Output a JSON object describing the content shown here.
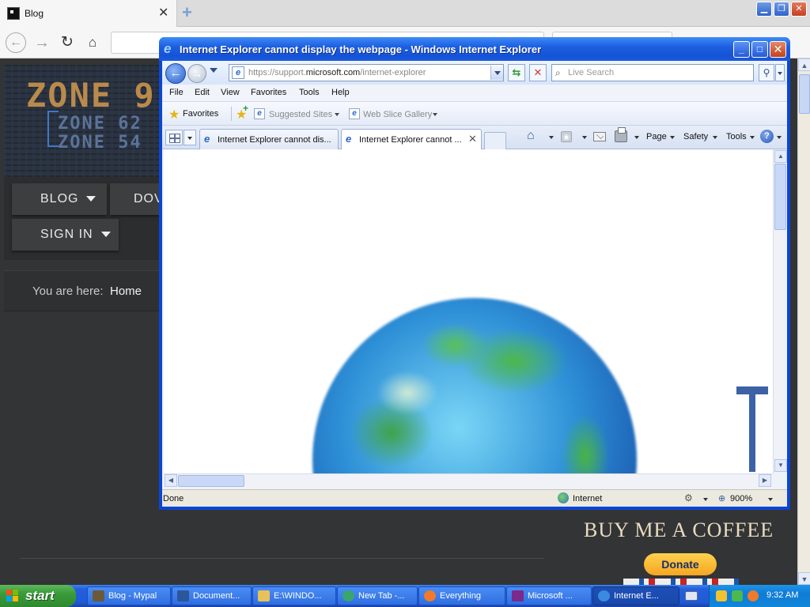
{
  "firefox": {
    "tab_title": "Blog",
    "tab_close": "✕",
    "new_tab": "+",
    "icons": [
      "back-icon",
      "forward-icon",
      "reload-icon",
      "home-icon"
    ]
  },
  "site": {
    "logo_main": "ZONE 9",
    "logo_line1": "ZONE 62",
    "logo_line2": "ZONE 54",
    "menu": {
      "blog": "BLOG",
      "downloads_partial": "DOV",
      "sign_in": "SIGN IN"
    },
    "breadcrumb_label": "You are here:",
    "breadcrumb_home": "Home",
    "coffee_title": "BUY ME A COFFEE",
    "donate_label": "Donate"
  },
  "ie": {
    "title": "Internet Explorer cannot display the webpage - Windows Internet Explorer",
    "url_prefix": "https://support.",
    "url_domain": "microsoft.com",
    "url_path": "/internet-explorer",
    "search_placeholder": "Live Search",
    "menu": [
      "File",
      "Edit",
      "View",
      "Favorites",
      "Tools",
      "Help"
    ],
    "favorites_label": "Favorites",
    "suggested_sites": "Suggested Sites",
    "web_slice_gallery": "Web Slice Gallery",
    "tabs": [
      {
        "label": "Internet Explorer cannot dis..."
      },
      {
        "label": "Internet Explorer cannot ..."
      }
    ],
    "commands": {
      "page": "Page",
      "safety": "Safety",
      "tools": "Tools"
    },
    "status": {
      "text": "Done",
      "zone": "Internet",
      "zoom": "900%"
    },
    "colors": {
      "titlebar": "#1553d6",
      "frame": "#0a46d6"
    }
  },
  "taskbar": {
    "start_label": "start",
    "tasks": [
      {
        "label": "Blog - Mypal"
      },
      {
        "label": "Document..."
      },
      {
        "label": "E:\\WINDO..."
      },
      {
        "label": "New Tab -..."
      },
      {
        "label": "Everything"
      },
      {
        "label": "Microsoft ..."
      },
      {
        "label": "Internet E..."
      }
    ],
    "clock": "9:32 AM"
  }
}
